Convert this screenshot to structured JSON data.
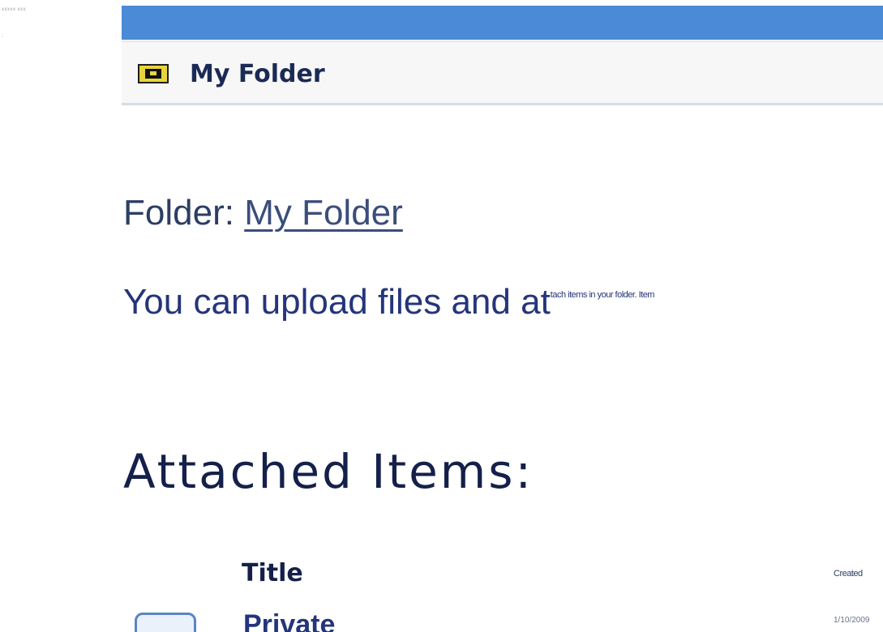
{
  "corner": {
    "text": "xxxxx xxx",
    "mark": ":"
  },
  "titlebar": {
    "icon": "folder-shortcut-icon",
    "label": "My Folder"
  },
  "folder": {
    "prefix": "Folder:",
    "link": "My Folder"
  },
  "upload": {
    "large": "You can upload files and at",
    "small": "tach items in your folder. Item"
  },
  "attached": {
    "heading": "Attached Items:"
  },
  "table": {
    "headers": {
      "title": "Title",
      "created": "Created"
    },
    "rows": [
      {
        "icon": "folder-icon",
        "title": "Private",
        "created": "1/10/2009"
      }
    ]
  },
  "colors": {
    "topbar": "#4a8ad6",
    "link": "#3a4e7a",
    "heading": "#15204a"
  }
}
